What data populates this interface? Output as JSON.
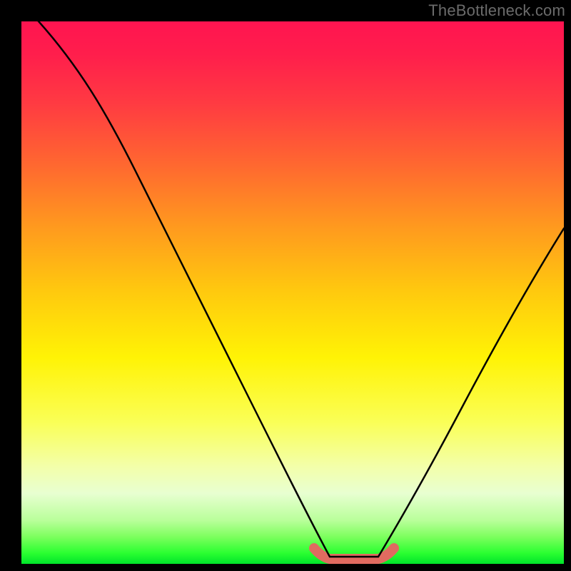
{
  "watermark": "TheBottleneck.com",
  "chart_data": {
    "type": "line",
    "title": "",
    "xlabel": "",
    "ylabel": "",
    "xlim": [
      0,
      100
    ],
    "ylim": [
      0,
      100
    ],
    "grid": false,
    "legend": null,
    "series": [
      {
        "name": "bottleneck-curve",
        "color": "#000000",
        "x": [
          2,
          10,
          20,
          30,
          40,
          50,
          55,
          58,
          60,
          63,
          66,
          70,
          80,
          90,
          100
        ],
        "y": [
          100,
          86,
          69,
          52,
          35,
          17,
          7,
          2,
          0,
          0,
          2,
          7,
          22,
          38,
          54
        ]
      }
    ],
    "highlight": {
      "name": "optimal-range",
      "color": "#e06b60",
      "x_range": [
        55,
        68
      ],
      "y": 0
    },
    "gradient_stops": [
      {
        "pos": 0,
        "color": "#ff1450"
      },
      {
        "pos": 15,
        "color": "#ff3a42"
      },
      {
        "pos": 38,
        "color": "#ff9a1e"
      },
      {
        "pos": 62,
        "color": "#fff305"
      },
      {
        "pos": 87,
        "color": "#e8ffd1"
      },
      {
        "pos": 100,
        "color": "#00e52a"
      }
    ]
  }
}
